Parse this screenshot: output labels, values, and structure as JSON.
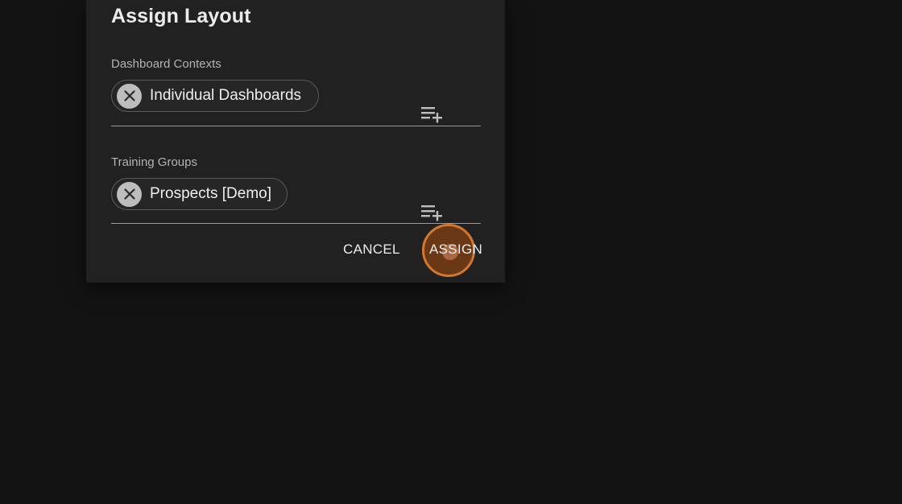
{
  "dialog": {
    "title": "Assign Layout",
    "dashboard_contexts": {
      "label": "Dashboard Contexts",
      "chips": [
        "Individual Dashboards"
      ],
      "add_icon": "playlist-add-icon",
      "remove_icon": "close-icon"
    },
    "training_groups": {
      "label": "Training Groups",
      "chips": [
        "Prospects [Demo]"
      ],
      "add_icon": "playlist-add-icon",
      "remove_icon": "close-icon"
    },
    "actions": {
      "cancel_label": "CANCEL",
      "assign_label": "ASSIGN"
    }
  },
  "colors": {
    "background": "#131313",
    "dialog": "#212121",
    "cursor_highlight": "#d2772e"
  }
}
